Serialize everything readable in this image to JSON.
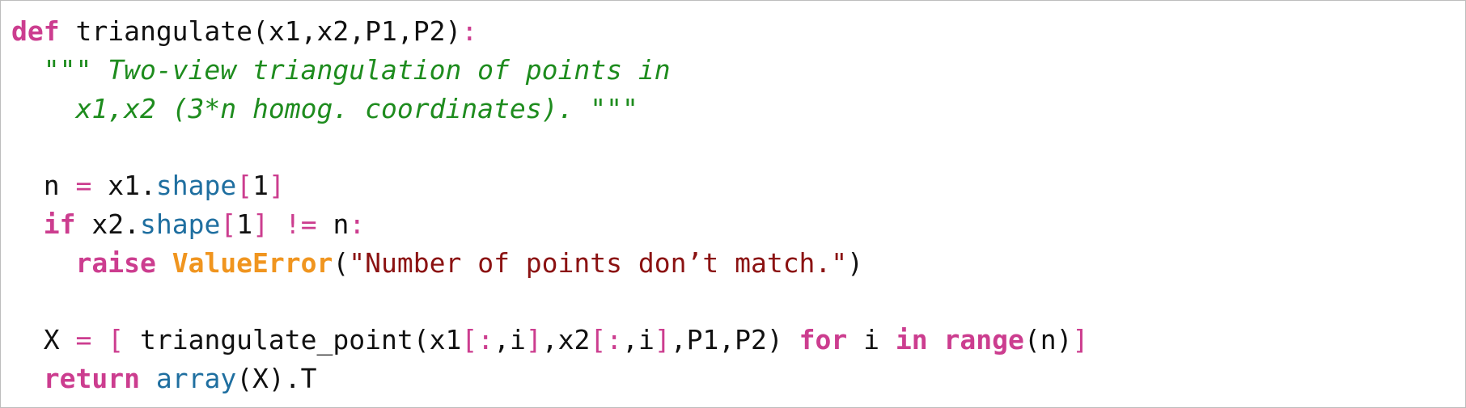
{
  "code": {
    "lines": [
      [
        {
          "t": "def",
          "c": "kw"
        },
        {
          "t": " triangulate(x1,x2,P1,P2)",
          "c": "plain"
        },
        {
          "t": ":",
          "c": "op"
        }
      ],
      [
        {
          "t": "  ",
          "c": "plain"
        },
        {
          "t": "\"\"\" Two-view triangulation of points in",
          "c": "doc"
        }
      ],
      [
        {
          "t": "    ",
          "c": "plain"
        },
        {
          "t": "x1,x2 (3*n homog. coordinates). \"\"\"",
          "c": "doc"
        }
      ],
      [
        {
          "t": "",
          "c": "plain"
        }
      ],
      [
        {
          "t": "  n ",
          "c": "plain"
        },
        {
          "t": "=",
          "c": "op"
        },
        {
          "t": " x1.",
          "c": "plain"
        },
        {
          "t": "shape",
          "c": "attr"
        },
        {
          "t": "[",
          "c": "op"
        },
        {
          "t": "1",
          "c": "plain"
        },
        {
          "t": "]",
          "c": "op"
        }
      ],
      [
        {
          "t": "  ",
          "c": "plain"
        },
        {
          "t": "if",
          "c": "kw"
        },
        {
          "t": " x2.",
          "c": "plain"
        },
        {
          "t": "shape",
          "c": "attr"
        },
        {
          "t": "[",
          "c": "op"
        },
        {
          "t": "1",
          "c": "plain"
        },
        {
          "t": "]",
          "c": "op"
        },
        {
          "t": " ",
          "c": "plain"
        },
        {
          "t": "!=",
          "c": "op"
        },
        {
          "t": " n",
          "c": "plain"
        },
        {
          "t": ":",
          "c": "op"
        }
      ],
      [
        {
          "t": "    ",
          "c": "plain"
        },
        {
          "t": "raise",
          "c": "kw"
        },
        {
          "t": " ",
          "c": "plain"
        },
        {
          "t": "ValueError",
          "c": "exc"
        },
        {
          "t": "(",
          "c": "plain"
        },
        {
          "t": "\"Number of points don’t match.\"",
          "c": "str"
        },
        {
          "t": ")",
          "c": "plain"
        }
      ],
      [
        {
          "t": "",
          "c": "plain"
        }
      ],
      [
        {
          "t": "  X ",
          "c": "plain"
        },
        {
          "t": "=",
          "c": "op"
        },
        {
          "t": " ",
          "c": "plain"
        },
        {
          "t": "[",
          "c": "op"
        },
        {
          "t": " triangulate_point(x1",
          "c": "plain"
        },
        {
          "t": "[:",
          "c": "op"
        },
        {
          "t": ",i",
          "c": "plain"
        },
        {
          "t": "]",
          "c": "op"
        },
        {
          "t": ",x2",
          "c": "plain"
        },
        {
          "t": "[:",
          "c": "op"
        },
        {
          "t": ",i",
          "c": "plain"
        },
        {
          "t": "]",
          "c": "op"
        },
        {
          "t": ",P1,P2) ",
          "c": "plain"
        },
        {
          "t": "for",
          "c": "kw"
        },
        {
          "t": " i ",
          "c": "plain"
        },
        {
          "t": "in",
          "c": "kw"
        },
        {
          "t": " ",
          "c": "plain"
        },
        {
          "t": "range",
          "c": "kw"
        },
        {
          "t": "(n)",
          "c": "plain"
        },
        {
          "t": "]",
          "c": "op"
        }
      ],
      [
        {
          "t": "  ",
          "c": "plain"
        },
        {
          "t": "return",
          "c": "kw"
        },
        {
          "t": " ",
          "c": "plain"
        },
        {
          "t": "array",
          "c": "attr"
        },
        {
          "t": "(X).T",
          "c": "plain"
        }
      ]
    ]
  }
}
